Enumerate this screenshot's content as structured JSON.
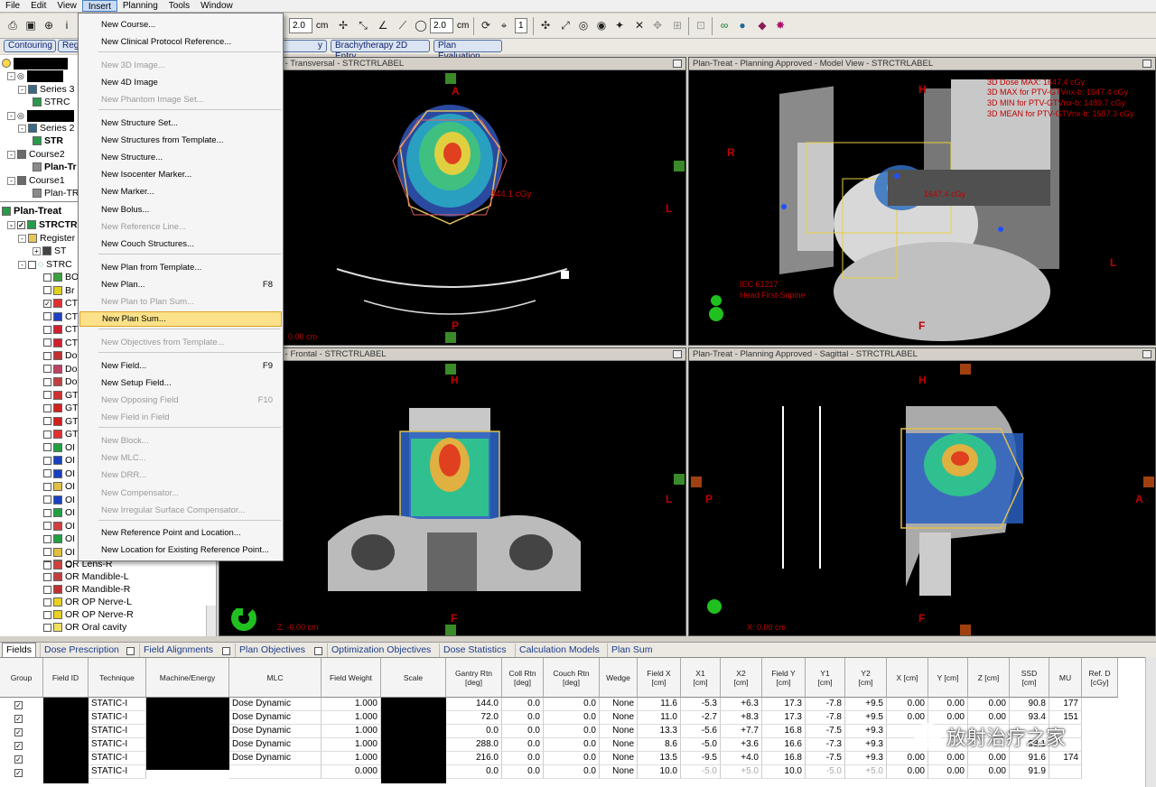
{
  "menubar": [
    "File",
    "Edit",
    "View",
    "Insert",
    "Planning",
    "Tools",
    "Window"
  ],
  "toolbar": {
    "zoom_value": "2.0",
    "zoom_unit": "cm",
    "step_value": "2.0",
    "step_unit": "cm",
    "slice_value": "1"
  },
  "workspaces": [
    "Contouring",
    "Reg",
    "y Planning",
    "Brachytherapy 2D Entry",
    "Plan Evaluation"
  ],
  "tree": {
    "series3": "Series 3",
    "strc_a": "STRC",
    "series2": "Series 2",
    "strc_b": "STR",
    "course2": "Course2",
    "plan_tr_a": "Plan-Tr",
    "course1": "Course1",
    "plan_tr_b": "Plan-TR",
    "plan_treat": "Plan-Treat",
    "strctr": "STRCTR",
    "registered": "Register",
    "st": "ST",
    "strc_c": "STRC",
    "structs": [
      "BO",
      "Br",
      "CT",
      "CT",
      "CT",
      "CT",
      "Do",
      "Do",
      "Do",
      "GT",
      "GT",
      "GT",
      "GT",
      "OI",
      "OI",
      "OI",
      "OI",
      "OI",
      "OI",
      "OI",
      "OI",
      "OI",
      "OI"
    ],
    "lens_r": "OR Lens-R",
    "mandible_l": "OR Mandible-L",
    "mandible_r": "OR Mandible-R",
    "op_nerve_l": "OR OP Nerve-L",
    "op_nerve_r": "OR OP Nerve-R",
    "oral_cavity": "OR Oral cavity"
  },
  "insert_menu": [
    {
      "label": "New Course...",
      "enabled": true
    },
    {
      "label": "New Clinical Protocol Reference...",
      "enabled": true
    },
    {
      "label": "New 3D Image...",
      "enabled": false
    },
    {
      "label": "New 4D Image",
      "enabled": true
    },
    {
      "label": "New Phantom Image Set...",
      "enabled": false
    },
    {
      "label": "New Structure Set...",
      "enabled": true
    },
    {
      "label": "New Structures from Template...",
      "enabled": true
    },
    {
      "label": "New Structure...",
      "enabled": true
    },
    {
      "label": "New Isocenter Marker...",
      "enabled": true
    },
    {
      "label": "New Marker...",
      "enabled": true
    },
    {
      "label": "New Bolus...",
      "enabled": true
    },
    {
      "label": "New Reference Line...",
      "enabled": false
    },
    {
      "label": "New Couch Structures...",
      "enabled": true
    },
    {
      "label": "New Plan from Template...",
      "enabled": true
    },
    {
      "label": "New Plan...",
      "enabled": true,
      "shortcut": "F8"
    },
    {
      "label": "New Plan to Plan Sum...",
      "enabled": false
    },
    {
      "label": "New Plan Sum...",
      "enabled": true,
      "highlighted": true
    },
    {
      "label": "New Objectives from Template...",
      "enabled": false
    },
    {
      "label": "New Field...",
      "enabled": true,
      "shortcut": "F9"
    },
    {
      "label": "New Setup Field...",
      "enabled": true
    },
    {
      "label": "New Opposing Field",
      "enabled": false,
      "shortcut": "F10"
    },
    {
      "label": "New Field in Field",
      "enabled": false
    },
    {
      "label": "New Block...",
      "enabled": false
    },
    {
      "label": "New MLC...",
      "enabled": false
    },
    {
      "label": "New DRR...",
      "enabled": false
    },
    {
      "label": "New Compensator...",
      "enabled": false
    },
    {
      "label": "New Irregular Surface Compensator...",
      "enabled": false
    },
    {
      "label": "New Reference Point and Location...",
      "enabled": true
    },
    {
      "label": "New Location for Existing Reference Point...",
      "enabled": true
    }
  ],
  "views": {
    "transversal": {
      "title": "nning Approved - Transversal - STRCTRLABEL",
      "A": "A",
      "P": "P",
      "L": "L",
      "dose": "544.1 cGy",
      "z": "0.00 cm"
    },
    "model": {
      "title": "Plan-Treat  -  Planning Approved  -  Model View  -  STRCTRLABEL",
      "H": "H",
      "R": "R",
      "L": "L",
      "F": "F",
      "stats": [
        "3D Dose MAX: 1647.4 cGy",
        "3D MAX for PTV-GTVnx-b: 1647.4 cGy",
        "3D MIN for PTV-GTVnx-b: 1489.7 cGy",
        "3D MEAN for PTV-GTVnx-b: 1597.3 cGy"
      ],
      "dose": "1647.4 cGy",
      "orientation": "IEC 61217",
      "position": "Head First-Supine"
    },
    "frontal": {
      "title": "nning Approved - Frontal - STRCTRLABEL",
      "H": "H",
      "F": "F",
      "R": "R",
      "L": "L",
      "z": "Z: -0.00 cm"
    },
    "sagittal": {
      "title": "Plan-Treat  -  Planning Approved  -  Sagittal  -  STRCTRLABEL",
      "H": "H",
      "F": "F",
      "P": "P",
      "A": "A",
      "x": "X: 0.00 cm"
    }
  },
  "panel_tabs": [
    "Fields",
    "Dose Prescription",
    "Field Alignments",
    "Plan Objectives",
    "Optimization Objectives",
    "Dose Statistics",
    "Calculation Models",
    "Plan Sum"
  ],
  "grid": {
    "headers": [
      "Group",
      "Field ID",
      "Technique",
      "Machine/Energy",
      "MLC",
      "Field Weight",
      "Scale",
      "Gantry Rtn\n[deg]",
      "Coll Rtn\n[deg]",
      "Couch Rtn\n[deg]",
      "Wedge",
      "Field X\n[cm]",
      "X1\n[cm]",
      "X2\n[cm]",
      "Field Y\n[cm]",
      "Y1\n[cm]",
      "Y2\n[cm]",
      "X [cm]",
      "Y [cm]",
      "Z [cm]",
      "SSD\n[cm]",
      "MU",
      "Ref. D\n[cGy]"
    ],
    "rows": [
      [
        "STATIC-I",
        "Dose Dynamic",
        "1.000",
        "144.0",
        "0.0",
        "0.0",
        "None",
        "11.6",
        "-5.3",
        "+6.3",
        "17.3",
        "-7.8",
        "+9.5",
        "0.00",
        "0.00",
        "0.00",
        "90.8",
        "177"
      ],
      [
        "STATIC-I",
        "Dose Dynamic",
        "1.000",
        "72.0",
        "0.0",
        "0.0",
        "None",
        "11.0",
        "-2.7",
        "+8.3",
        "17.3",
        "-7.8",
        "+9.5",
        "0.00",
        "0.00",
        "0.00",
        "93.4",
        "151"
      ],
      [
        "STATIC-I",
        "Dose Dynamic",
        "1.000",
        "0.0",
        "0.0",
        "0.0",
        "None",
        "13.3",
        "-5.6",
        "+7.7",
        "16.8",
        "-7.5",
        "+9.3",
        "",
        "",
        "",
        "",
        ""
      ],
      [
        "STATIC-I",
        "Dose Dynamic",
        "1.000",
        "288.0",
        "0.0",
        "0.0",
        "None",
        "8.6",
        "-5.0",
        "+3.6",
        "16.6",
        "-7.3",
        "+9.3",
        "",
        "",
        "",
        "93.1",
        ""
      ],
      [
        "STATIC-I",
        "Dose Dynamic",
        "1.000",
        "216.0",
        "0.0",
        "0.0",
        "None",
        "13.5",
        "-9.5",
        "+4.0",
        "16.8",
        "-7.5",
        "+9.3",
        "0.00",
        "0.00",
        "0.00",
        "91.6",
        "174"
      ],
      [
        "STATIC-I",
        "",
        "0.000",
        "0.0",
        "0.0",
        "0.0",
        "None",
        "10.0",
        "-5.0",
        "+5.0",
        "10.0",
        "-5.0",
        "+5.0",
        "0.00",
        "0.00",
        "0.00",
        "91.9",
        ""
      ]
    ]
  },
  "watermark": "放射治疗之家"
}
